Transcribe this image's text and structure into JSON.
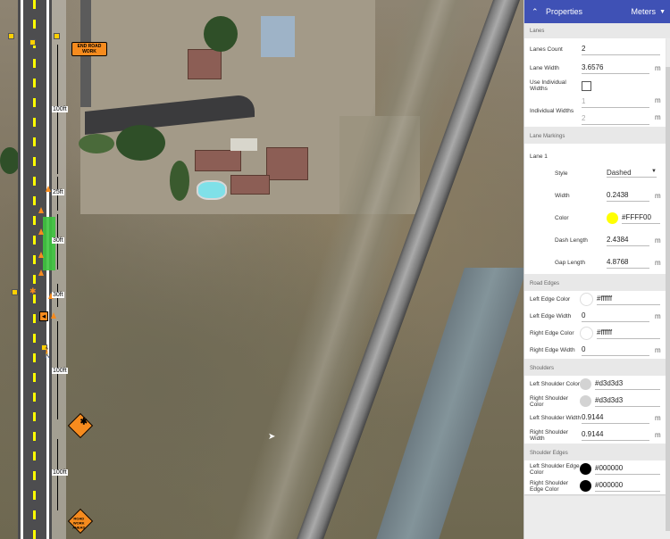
{
  "map": {
    "labels": {
      "end_road_work": "END ROAD WORK",
      "road_work_ahead": "ROAD WORK AHEAD",
      "dim_100ft_top": "100ft",
      "dim_25ft": "25ft",
      "dim_30ft_a": "30ft",
      "dim_30ft_b": "30ft",
      "dim_100ft_mid": "100ft",
      "dim_100ft_bottom": "100ft"
    },
    "colors": {
      "accent": "#f68b1e",
      "center_line": "#ffff00",
      "green_zone": "#3ec43e"
    }
  },
  "panel": {
    "header": {
      "title": "Properties",
      "units": "Meters",
      "collapse_icon": "chevron-up-icon",
      "units_icon": "caret-down-icon",
      "color": "#3f51b5"
    },
    "lanes": {
      "section": "Lanes",
      "lanes_count_label": "Lanes Count",
      "lanes_count": "2",
      "lane_width_label": "Lane Width",
      "lane_width": "3.6576",
      "lane_width_unit": "m",
      "use_individual_label": "Use Individual Widths",
      "individual_label": "Individual Widths",
      "individual_1": "1",
      "individual_2": "2",
      "unit_m": "m"
    },
    "lane_markings": {
      "section": "Lane Markings",
      "lane_label": "Lane 1",
      "style_label": "Style",
      "style_value": "Dashed",
      "width_label": "Width",
      "width_value": "0.2438",
      "color_label": "Color",
      "color_value": "#FFFF00",
      "dash_length_label": "Dash Length",
      "dash_length_value": "2.4384",
      "gap_length_label": "Gap Length",
      "gap_length_value": "4.8768",
      "unit_m": "m"
    },
    "road_edges": {
      "section": "Road Edges",
      "left_color_label": "Left Edge Color",
      "left_color": "#ffffff",
      "left_width_label": "Left Edge Width",
      "left_width": "0",
      "right_color_label": "Right Edge Color",
      "right_color": "#ffffff",
      "right_width_label": "Right Edge Width",
      "right_width": "0",
      "unit_m": "m"
    },
    "shoulders": {
      "section": "Shoulders",
      "left_color_label": "Left Shoulder Color",
      "left_color": "#d3d3d3",
      "right_color_label": "Right Shoulder Color",
      "right_color": "#d3d3d3",
      "left_width_label": "Left Shoulder Width",
      "left_width": "0.9144",
      "right_width_label": "Right Shoulder Width",
      "right_width": "0.9144",
      "unit_m": "m"
    },
    "shoulder_edges": {
      "section": "Shoulder Edges",
      "left_color_label": "Left Shoulder Edge Color",
      "left_color": "#000000",
      "right_color_label": "Right Shoulder Edge Color",
      "right_color": "#000000"
    }
  }
}
